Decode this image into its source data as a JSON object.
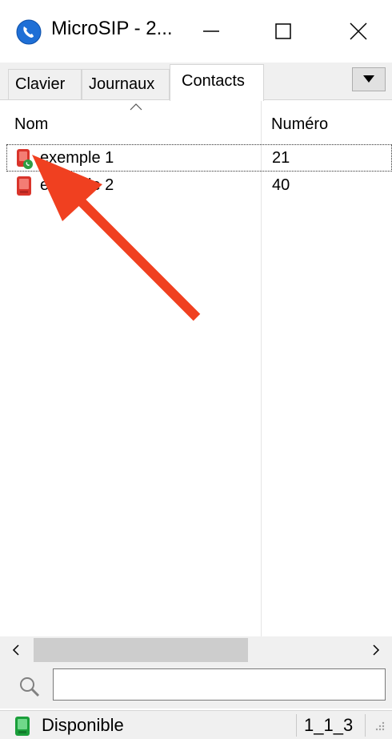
{
  "window": {
    "title": "MicroSIP - 2...",
    "minimize_label": "",
    "maximize_label": "",
    "close_label": ""
  },
  "tabs": [
    {
      "label": "Clavier"
    },
    {
      "label": "Journaux"
    },
    {
      "label": "Contacts"
    }
  ],
  "active_tab": "Contacts",
  "columns": {
    "name": "Nom",
    "number": "Numéro"
  },
  "contacts": [
    {
      "name": "exemple 1",
      "number": "21",
      "presence": "online",
      "selected": true
    },
    {
      "name": "exemple 2",
      "number": "40",
      "presence": "offline",
      "selected": false
    }
  ],
  "search": {
    "value": "",
    "placeholder": ""
  },
  "status": {
    "text": "Disponible",
    "code": "1_1_3"
  },
  "colors": {
    "annotation_arrow": "#f04020",
    "contact_icon": "#d9342b",
    "presence_online": "#2e9e44",
    "status_icon": "#1a9e3a",
    "app_icon": "#1e6fd6"
  },
  "icons": {
    "app": "microsip-phone-icon",
    "search": "search-icon",
    "status": "status-available-icon",
    "tab_menu": "dropdown-arrow-icon"
  }
}
